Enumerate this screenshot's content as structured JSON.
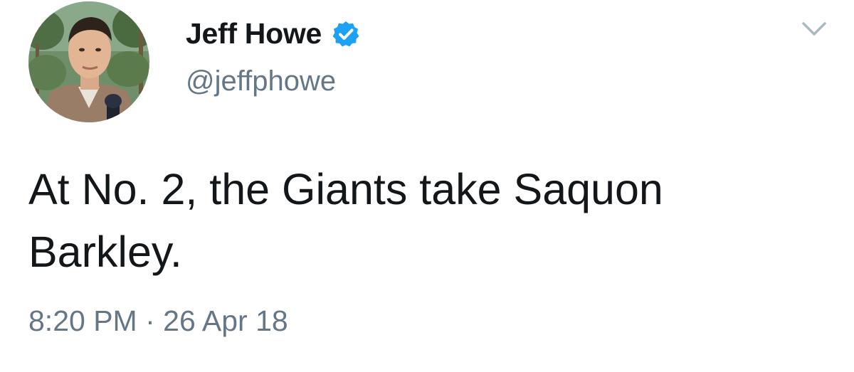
{
  "user": {
    "display_name": "Jeff Howe",
    "handle": "@jeffphowe",
    "verified": true
  },
  "icons": {
    "verified": "verified-badge-icon",
    "more": "chevron-down-icon",
    "avatar": "profile-photo"
  },
  "tweet": {
    "text": "At No. 2, the Giants take Saquon Barkley.",
    "time": "8:20 PM",
    "separator": "·",
    "date": "26 Apr 18"
  },
  "colors": {
    "text": "#14171a",
    "secondary": "#657786",
    "verified_blue": "#1da1f2",
    "caret": "#aab8c2"
  }
}
